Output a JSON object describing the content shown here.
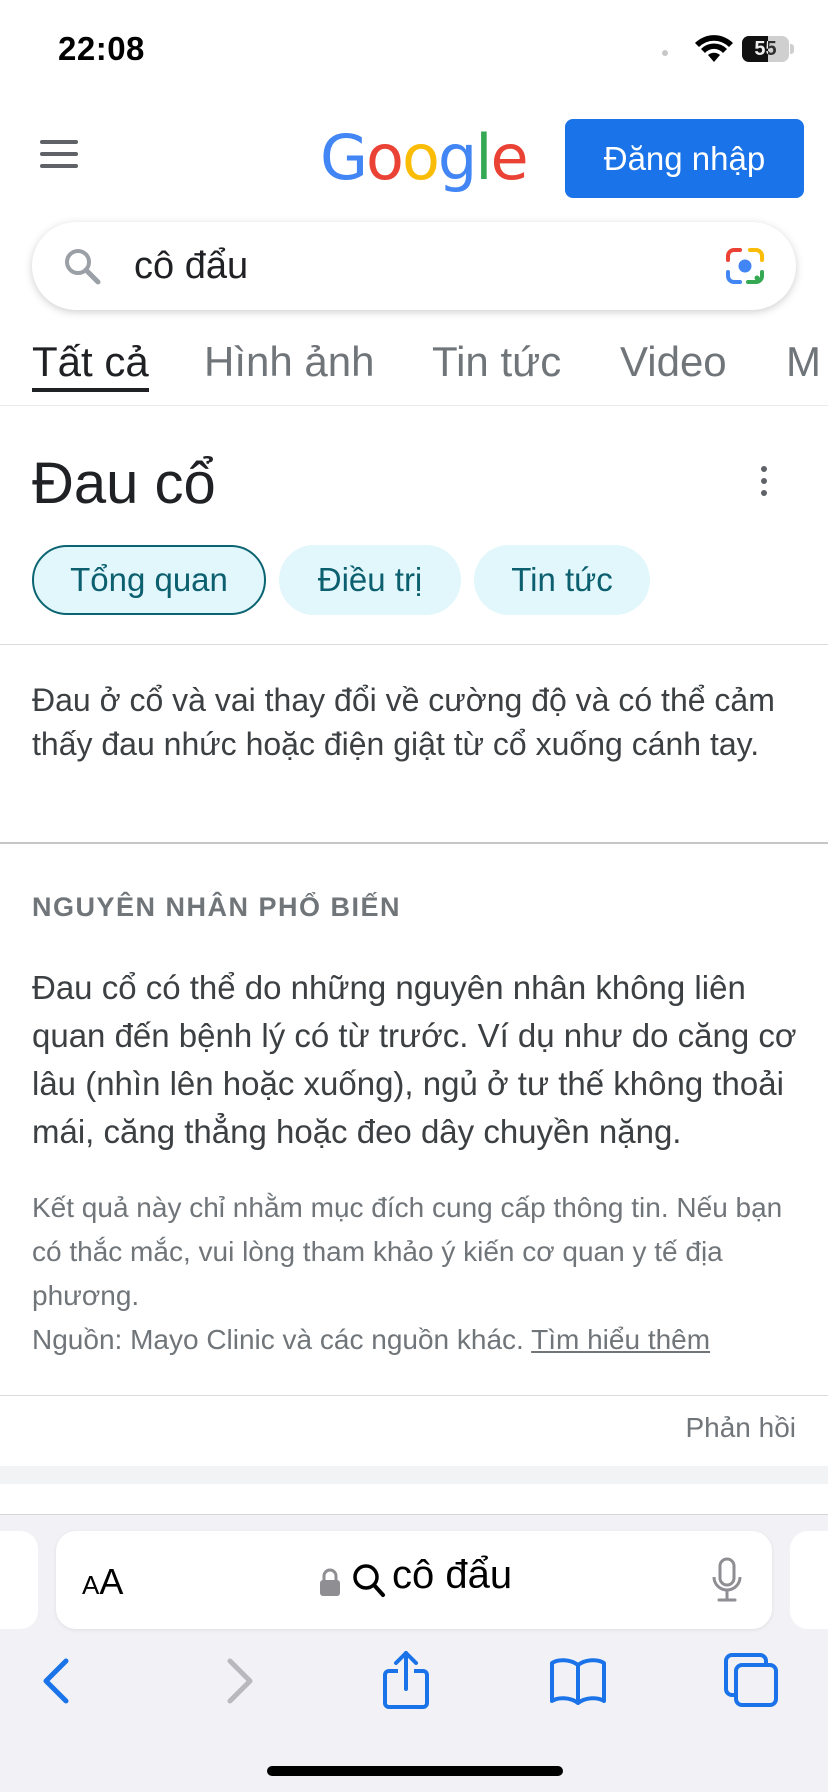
{
  "status": {
    "time": "22:08",
    "battery": "55",
    "battery_level_percent": 55
  },
  "header": {
    "logo_text": "Google",
    "signin_label": "Đăng nhập"
  },
  "search": {
    "query": "cô đẩu"
  },
  "tabs": [
    {
      "label": "Tất cả",
      "active": true
    },
    {
      "label": "Hình ảnh"
    },
    {
      "label": "Tin tức"
    },
    {
      "label": "Video"
    },
    {
      "label": "M"
    }
  ],
  "panel": {
    "title": "Đau cổ",
    "chips": [
      {
        "label": "Tổng quan",
        "active": true
      },
      {
        "label": "Điều trị"
      },
      {
        "label": "Tin tức"
      }
    ],
    "summary": "Đau ở cổ và vai thay đổi về cường độ và có thể cảm thấy đau nhức hoặc điện giật từ cổ xuống cánh tay.",
    "section_heading": "NGUYÊN NHÂN PHỔ BIẾN",
    "section_text": "Đau cổ có thể do những nguyên nhân không liên quan đến bệnh lý có từ trước. Ví dụ như do căng cơ lâu (nhìn lên hoặc xuống), ngủ ở tư thế không thoải mái, căng thẳng hoặc đeo dây chuyền nặng.",
    "disclaimer": "Kết quả này chỉ nhằm mục đích cung cấp thông tin. Nếu bạn có thắc mắc, vui lòng tham khảo ý kiến cơ quan y tế địa phương.",
    "source_text": "Nguồn: Mayo Clinic và các nguồn khác.",
    "learn_more": "Tìm hiểu thêm",
    "feedback": "Phản hồi"
  },
  "browser": {
    "text_size_label": "AA",
    "address_text": "cô đẩu"
  },
  "colors": {
    "google_blue": "#1a73e8",
    "chip_bg": "#e1f7fb",
    "chip_text": "#0b5f6e",
    "ios_blue": "#1a73e8"
  }
}
